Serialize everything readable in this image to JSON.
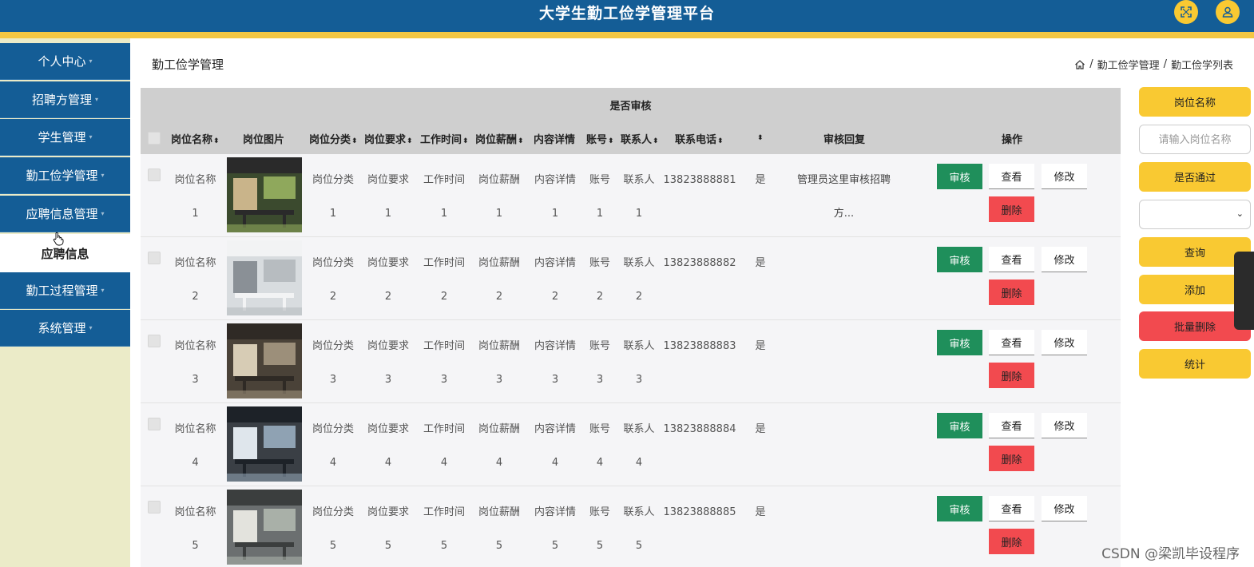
{
  "app": {
    "title": "大学生勤工俭学管理平台"
  },
  "header_icons": [
    "fullscreen-icon",
    "user-icon"
  ],
  "sidebar": {
    "items": [
      {
        "label": "个人中心"
      },
      {
        "label": "招聘方管理"
      },
      {
        "label": "学生管理"
      },
      {
        "label": "勤工俭学管理"
      },
      {
        "label": "应聘信息管理"
      },
      {
        "label": "应聘信息",
        "active": true
      },
      {
        "label": "勤工过程管理"
      },
      {
        "label": "系统管理"
      }
    ]
  },
  "page": {
    "title": "勤工俭学管理",
    "breadcrumb": [
      "勤工俭学管理",
      "勤工俭学列表"
    ],
    "breadcrumb_sep": "/"
  },
  "table": {
    "group_header": "是否审核",
    "columns": [
      "岗位名称",
      "岗位图片",
      "岗位分类",
      "岗位要求",
      "工作时间",
      "岗位薪酬",
      "内容详情",
      "账号",
      "联系人",
      "联系电话",
      "",
      "审核回复",
      "操作"
    ],
    "sort_glyph": "⬍",
    "actions": {
      "audit": "审核",
      "view": "查看",
      "edit": "修改",
      "delete": "删除"
    },
    "rows": [
      {
        "name": "岗位名称",
        "idx": "1",
        "category": "岗位分类",
        "requirement": "岗位要求",
        "worktime": "工作时间",
        "salary": "岗位薪酬",
        "detail": "内容详情",
        "account": "账号",
        "contact": "联系人",
        "phone": "13823888881",
        "approved": "是",
        "reply1": "管理员这里审核招聘",
        "reply2": "方..."
      },
      {
        "name": "岗位名称",
        "idx": "2",
        "category": "岗位分类",
        "requirement": "岗位要求",
        "worktime": "工作时间",
        "salary": "岗位薪酬",
        "detail": "内容详情",
        "account": "账号",
        "contact": "联系人",
        "phone": "13823888882",
        "approved": "是",
        "reply1": "",
        "reply2": ""
      },
      {
        "name": "岗位名称",
        "idx": "3",
        "category": "岗位分类",
        "requirement": "岗位要求",
        "worktime": "工作时间",
        "salary": "岗位薪酬",
        "detail": "内容详情",
        "account": "账号",
        "contact": "联系人",
        "phone": "13823888883",
        "approved": "是",
        "reply1": "",
        "reply2": ""
      },
      {
        "name": "岗位名称",
        "idx": "4",
        "category": "岗位分类",
        "requirement": "岗位要求",
        "worktime": "工作时间",
        "salary": "岗位薪酬",
        "detail": "内容详情",
        "account": "账号",
        "contact": "联系人",
        "phone": "13823888884",
        "approved": "是",
        "reply1": "",
        "reply2": ""
      },
      {
        "name": "岗位名称",
        "idx": "5",
        "category": "岗位分类",
        "requirement": "岗位要求",
        "worktime": "工作时间",
        "salary": "岗位薪酬",
        "detail": "内容详情",
        "account": "账号",
        "contact": "联系人",
        "phone": "13823888885",
        "approved": "是",
        "reply1": "",
        "reply2": ""
      }
    ]
  },
  "right_panel": {
    "label_name": "岗位名称",
    "name_placeholder": "请输入岗位名称",
    "label_pass": "是否通过",
    "pass_value": "",
    "search": "查询",
    "add": "添加",
    "batch_delete": "批量删除",
    "stats": "统计"
  },
  "watermark": "CSDN @梁凯毕设程序",
  "colors": {
    "header": "#145d96",
    "accent": "#f9c932",
    "stripe": "#f4c743",
    "audit": "#1f8f5b",
    "danger": "#f24a4f",
    "sidebar_bg": "#ebebc8"
  }
}
